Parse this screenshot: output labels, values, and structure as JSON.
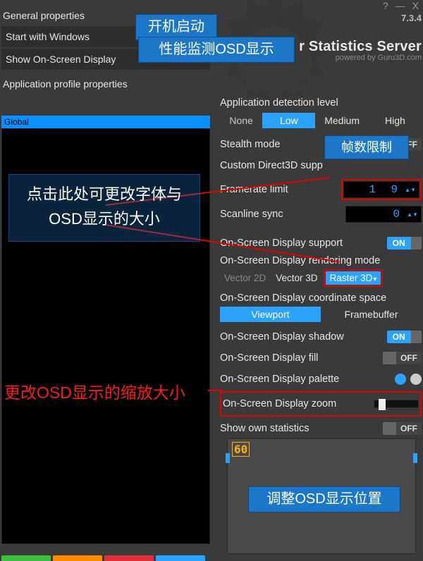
{
  "window": {
    "title_suffix": "r Statistics Server",
    "powered_by": "powered by Guru3D.com",
    "version": "7.3.4",
    "help": "?",
    "minimize": "—",
    "close": "X"
  },
  "left_panel": {
    "general_header": "General properties",
    "start_with_windows": "Start with Windows",
    "show_osd": "Show On-Screen Display",
    "app_profile_header": "Application profile properties",
    "global": "Global"
  },
  "right_panel": {
    "detection_label": "Application detection level",
    "detection_options": {
      "none": "None",
      "low": "Low",
      "medium": "Medium",
      "high": "High"
    },
    "stealth": "Stealth mode",
    "custom_d3d": "Custom Direct3D supp",
    "framerate_limit": {
      "label": "Framerate limit",
      "value": "1 9"
    },
    "scanline_sync": {
      "label": "Scanline sync",
      "value": "0"
    },
    "osd_support": "On-Screen Display support",
    "osd_render_mode": "On-Screen Display rendering mode",
    "render_modes": {
      "v2d": "Vector 2D",
      "v3d": "Vector 3D",
      "r3d": "Raster 3D"
    },
    "coord_space": "On-Screen Display coordinate space",
    "coord_options": {
      "viewport": "Viewport",
      "framebuffer": "Framebuffer"
    },
    "osd_shadow": "On-Screen Display shadow",
    "osd_fill": "On-Screen Display fill",
    "osd_palette": "On-Screen Display palette",
    "osd_zoom": "On-Screen Display zoom",
    "show_own_stats": "Show own statistics",
    "palette_colors": [
      "#ff8c00",
      "#2aa3ff",
      "#cccccc"
    ],
    "toggle": {
      "on": "ON",
      "off": "OFF"
    }
  },
  "preview": {
    "fps": "60"
  },
  "annotations": {
    "startup": "开机启动",
    "osd_show": "性能监测OSD显示",
    "fps_limit": "帧数限制",
    "font_size": "点击此处可更改字体与OSD显示的大小",
    "zoom_scale": "更改OSD显示的缩放大小",
    "position": "调整OSD显示位置"
  },
  "tabs": {
    "colors": [
      "#3cbf3c",
      "#ff8c00",
      "#e03040",
      "#2aa3ff"
    ]
  }
}
